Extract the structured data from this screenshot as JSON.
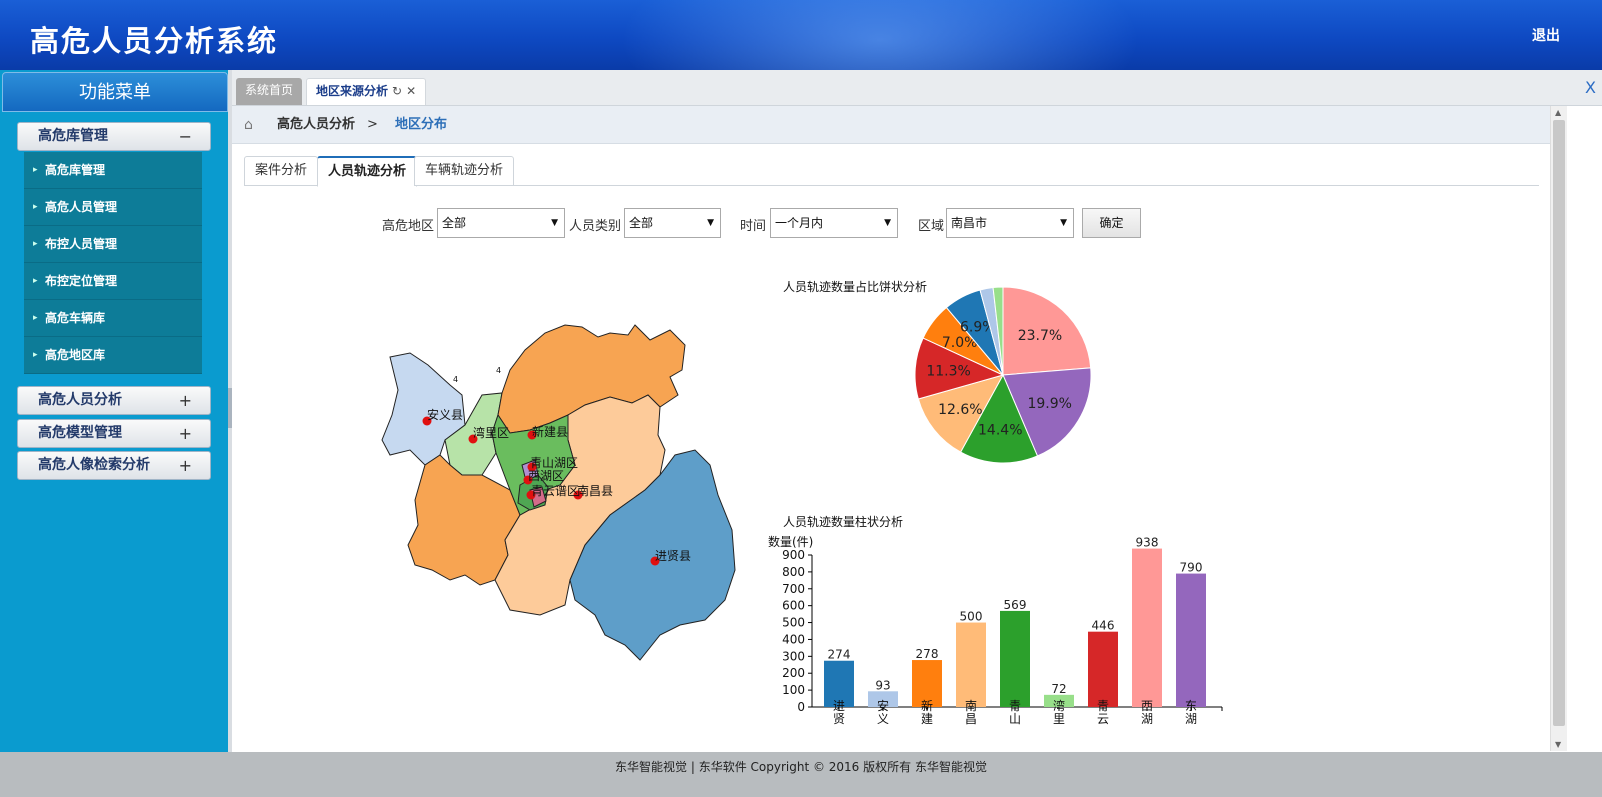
{
  "header": {
    "title": "高危人员分析系统",
    "logout": "退出"
  },
  "sidebar": {
    "title": "功能菜单",
    "groups": [
      {
        "label": "高危库管理",
        "toggle": "−"
      },
      {
        "label": "高危人员分析",
        "toggle": "+"
      },
      {
        "label": "高危模型管理",
        "toggle": "+"
      },
      {
        "label": "高危人像检索分析",
        "toggle": "+"
      }
    ],
    "items": [
      "高危库管理",
      "高危人员管理",
      "布控人员管理",
      "布控定位管理",
      "高危车辆库",
      "高危地区库"
    ]
  },
  "tabs": {
    "home": "系统首页",
    "active": "地区来源分析",
    "refresh": "↻",
    "close": "✕",
    "close_all": "X"
  },
  "breadcrumb": {
    "parent": "高危人员分析",
    "sep": ">",
    "current": "地区分布"
  },
  "inner_tabs": [
    "案件分析",
    "人员轨迹分析",
    "车辆轨迹分析"
  ],
  "filters": {
    "area_label": "高危地区",
    "area_value": "全部",
    "type_label": "人员类别",
    "type_value": "全部",
    "time_label": "时间",
    "time_value": "一个月内",
    "region_label": "区域",
    "region_value": "南昌市",
    "submit": "确定"
  },
  "map": {
    "labels": [
      "安义县",
      "湾里区",
      "新建县",
      "青山湖区",
      "西湖区",
      "青云谱区",
      "南昌县",
      "进贤县",
      "4",
      "4"
    ]
  },
  "colors": {
    "accent": "#1f6db8",
    "header": "#0e49c2",
    "sidebar": "#0a9bcf"
  },
  "chart_data": [
    {
      "type": "pie",
      "title": "人员轨迹数量占比饼状分析",
      "slices": [
        {
          "value": 23.7,
          "label": "23.7%",
          "color": "#ff9896"
        },
        {
          "value": 19.9,
          "label": "19.9%",
          "color": "#9467bd"
        },
        {
          "value": 14.4,
          "label": "14.4%",
          "color": "#2ca02c"
        },
        {
          "value": 12.6,
          "label": "12.6%",
          "color": "#ffbb78"
        },
        {
          "value": 11.3,
          "label": "11.3%",
          "color": "#d62728"
        },
        {
          "value": 7.0,
          "label": "7.0%",
          "color": "#ff7f0e"
        },
        {
          "value": 6.9,
          "label": "6.9%",
          "color": "#1f77b4"
        },
        {
          "value": 2.4,
          "label": "",
          "color": "#aec7e8"
        },
        {
          "value": 1.8,
          "label": "",
          "color": "#98df8a"
        }
      ]
    },
    {
      "type": "bar",
      "title": "人员轨迹数量柱状分析",
      "ylabel": "数量(件)",
      "ylim": [
        0,
        900
      ],
      "yticks": [
        0,
        100,
        200,
        300,
        400,
        500,
        600,
        700,
        800,
        900
      ],
      "categories": [
        "进贤",
        "安义",
        "新建",
        "南昌",
        "青山",
        "湾里",
        "青云",
        "西湖",
        "东湖"
      ],
      "values": [
        274,
        93,
        278,
        500,
        569,
        72,
        446,
        938,
        790
      ],
      "colors": [
        "#1f77b4",
        "#aec7e8",
        "#ff7f0e",
        "#ffbb78",
        "#2ca02c",
        "#98df8a",
        "#d62728",
        "#ff9896",
        "#9467bd"
      ]
    }
  ]
}
